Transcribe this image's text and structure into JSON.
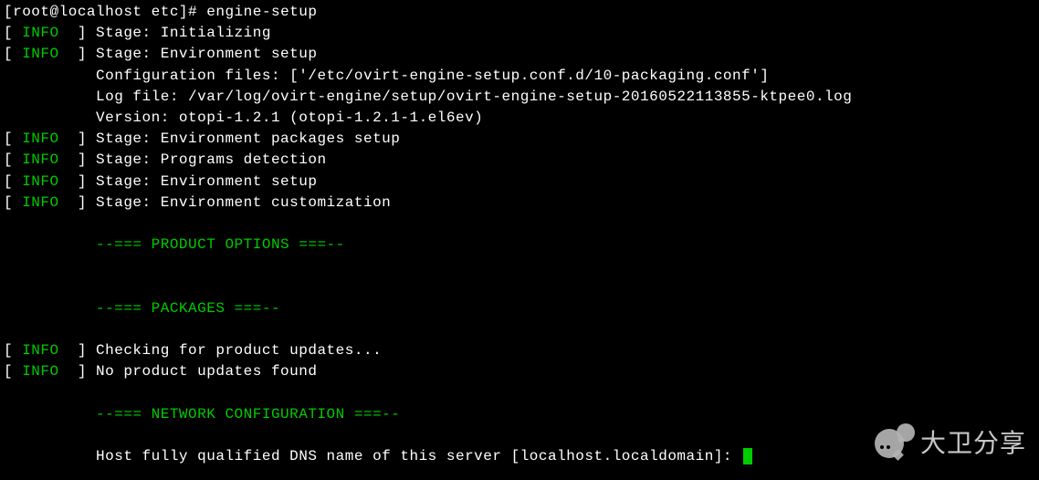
{
  "prompt": {
    "user_host": "[root@localhost etc]#",
    "command": "engine-setup"
  },
  "info_label": "INFO",
  "indent": "          ",
  "lines": {
    "s1": "Stage: Initializing",
    "s2": "Stage: Environment setup",
    "s3": "Configuration files: ['/etc/ovirt-engine-setup.conf.d/10-packaging.conf']",
    "s4": "Log file: /var/log/ovirt-engine/setup/ovirt-engine-setup-20160522113855-ktpee0.log",
    "s5": "Version: otopi-1.2.1 (otopi-1.2.1-1.el6ev)",
    "s6": "Stage: Environment packages setup",
    "s7": "Stage: Programs detection",
    "s8": "Stage: Environment setup",
    "s9": "Stage: Environment customization",
    "sec1": "--=== PRODUCT OPTIONS ===--",
    "sec2": "--=== PACKAGES ===--",
    "s10": "Checking for product updates...",
    "s11": "No product updates found",
    "sec3": "--=== NETWORK CONFIGURATION ===--",
    "s12": "Host fully qualified DNS name of this server [localhost.localdomain]: "
  },
  "watermark": "大卫分享"
}
